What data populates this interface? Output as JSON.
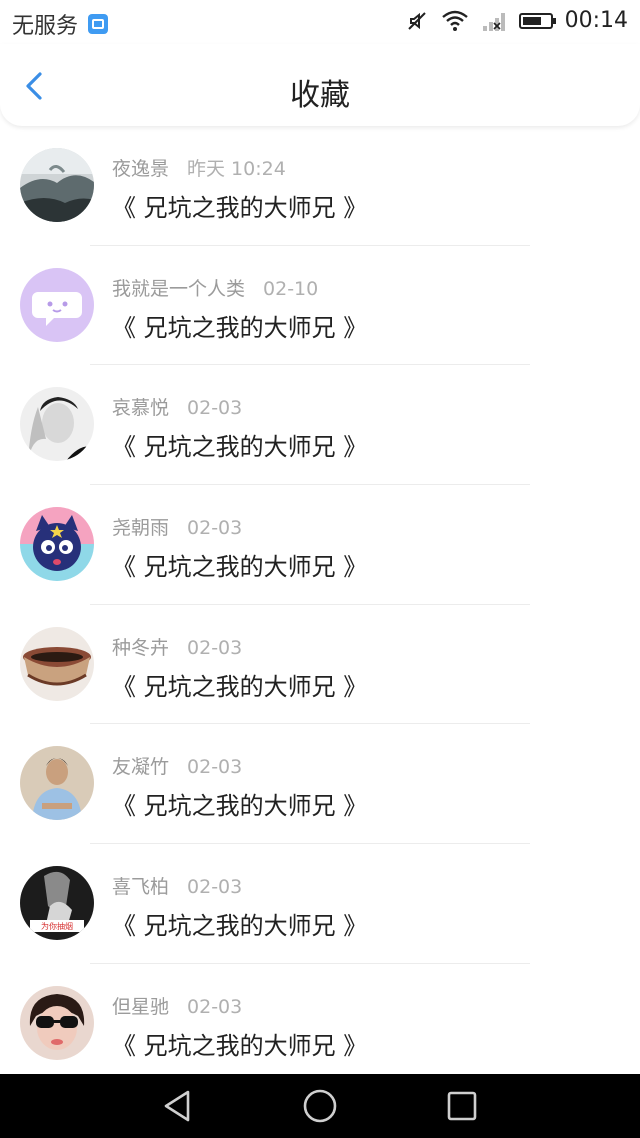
{
  "status_bar": {
    "carrier": "无服务",
    "time": "00:14",
    "battery_level": 0.7,
    "icons": [
      "app-notification-icon",
      "mute-icon",
      "wifi-icon",
      "no-signal-icon",
      "battery-icon"
    ]
  },
  "header": {
    "title": "收藏",
    "back_icon": "chevron-left-icon"
  },
  "items": [
    {
      "name": "夜逸景",
      "time": "昨天 10:24",
      "book": "《 兄坑之我的大师兄 》"
    },
    {
      "name": "我就是一个人类",
      "time": "02-10",
      "book": "《 兄坑之我的大师兄 》"
    },
    {
      "name": "哀慕悦",
      "time": "02-03",
      "book": "《 兄坑之我的大师兄 》"
    },
    {
      "name": "尧朝雨",
      "time": "02-03",
      "book": "《 兄坑之我的大师兄 》"
    },
    {
      "name": "种冬卉",
      "time": "02-03",
      "book": "《 兄坑之我的大师兄 》"
    },
    {
      "name": "友凝竹",
      "time": "02-03",
      "book": "《 兄坑之我的大师兄 》"
    },
    {
      "name": "喜飞柏",
      "time": "02-03",
      "book": "《 兄坑之我的大师兄 》"
    },
    {
      "name": "但星驰",
      "time": "02-03",
      "book": "《 兄坑之我的大师兄 》"
    }
  ],
  "avatar_sticker_text": "为你抽烟",
  "colors": {
    "accent": "#3a8ee6",
    "text_primary": "#222222",
    "text_secondary": "#9b9b9b"
  },
  "nav_bar": [
    "back-triangle-icon",
    "home-circle-icon",
    "recents-square-icon"
  ]
}
